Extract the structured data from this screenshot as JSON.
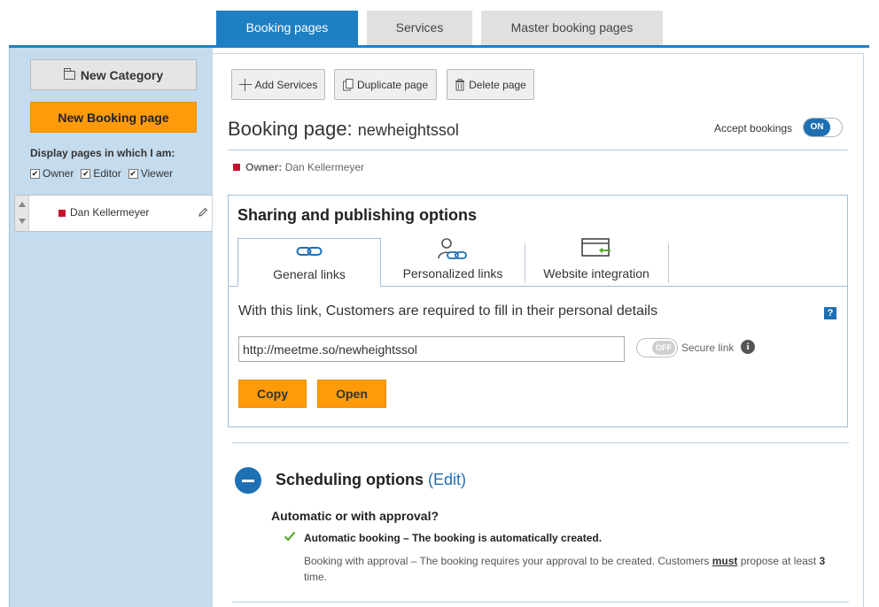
{
  "top_tabs": {
    "booking_pages": "Booking pages",
    "services": "Services",
    "master_booking_pages": "Master booking pages"
  },
  "sidebar": {
    "new_category": "New Category",
    "new_booking_page": "New Booking page",
    "display_label": "Display pages in which I am:",
    "filters": {
      "owner": "Owner",
      "editor": "Editor",
      "viewer": "Viewer"
    },
    "pages": [
      {
        "name": "Dan Kellermeyer"
      }
    ]
  },
  "toolbar": {
    "add_services": "Add Services",
    "duplicate_page": "Duplicate page",
    "delete_page": "Delete page"
  },
  "booking_page": {
    "title_prefix": "Booking page:",
    "name": "newheightssol",
    "accept_bookings_label": "Accept bookings",
    "accept_bookings_state": "ON",
    "owner_label": "Owner:",
    "owner_name": "Dan Kellermeyer"
  },
  "sharing": {
    "title": "Sharing and publishing options",
    "tabs": {
      "general_links": "General links",
      "personalized_links": "Personalized links",
      "website_integration": "Website integration"
    },
    "description": "With this link, Customers are required to fill in their personal details",
    "help": "?",
    "link_value": "http://meetme.so/newheightssol",
    "secure_state": "OFF",
    "secure_label": "Secure link",
    "info": "i",
    "copy": "Copy",
    "open": "Open"
  },
  "scheduling": {
    "title": "Scheduling options",
    "edit_open": "(",
    "edit": "Edit",
    "edit_close": ")",
    "question": "Automatic or with approval?",
    "auto_option": "Automatic booking – The booking is automatically created.",
    "approval_prefix": "Booking with approval – The booking requires your approval to be created. Customers",
    "approval_must": "must",
    "approval_mid": "propose at least",
    "approval_count": "3",
    "approval_suffix": "time."
  },
  "colors": {
    "accent_blue": "#1f7fc3",
    "orange": "#ff9b0a",
    "sidebar_bg": "#c5dcee",
    "owner_red": "#c8102e",
    "check_green": "#5aab2e"
  }
}
